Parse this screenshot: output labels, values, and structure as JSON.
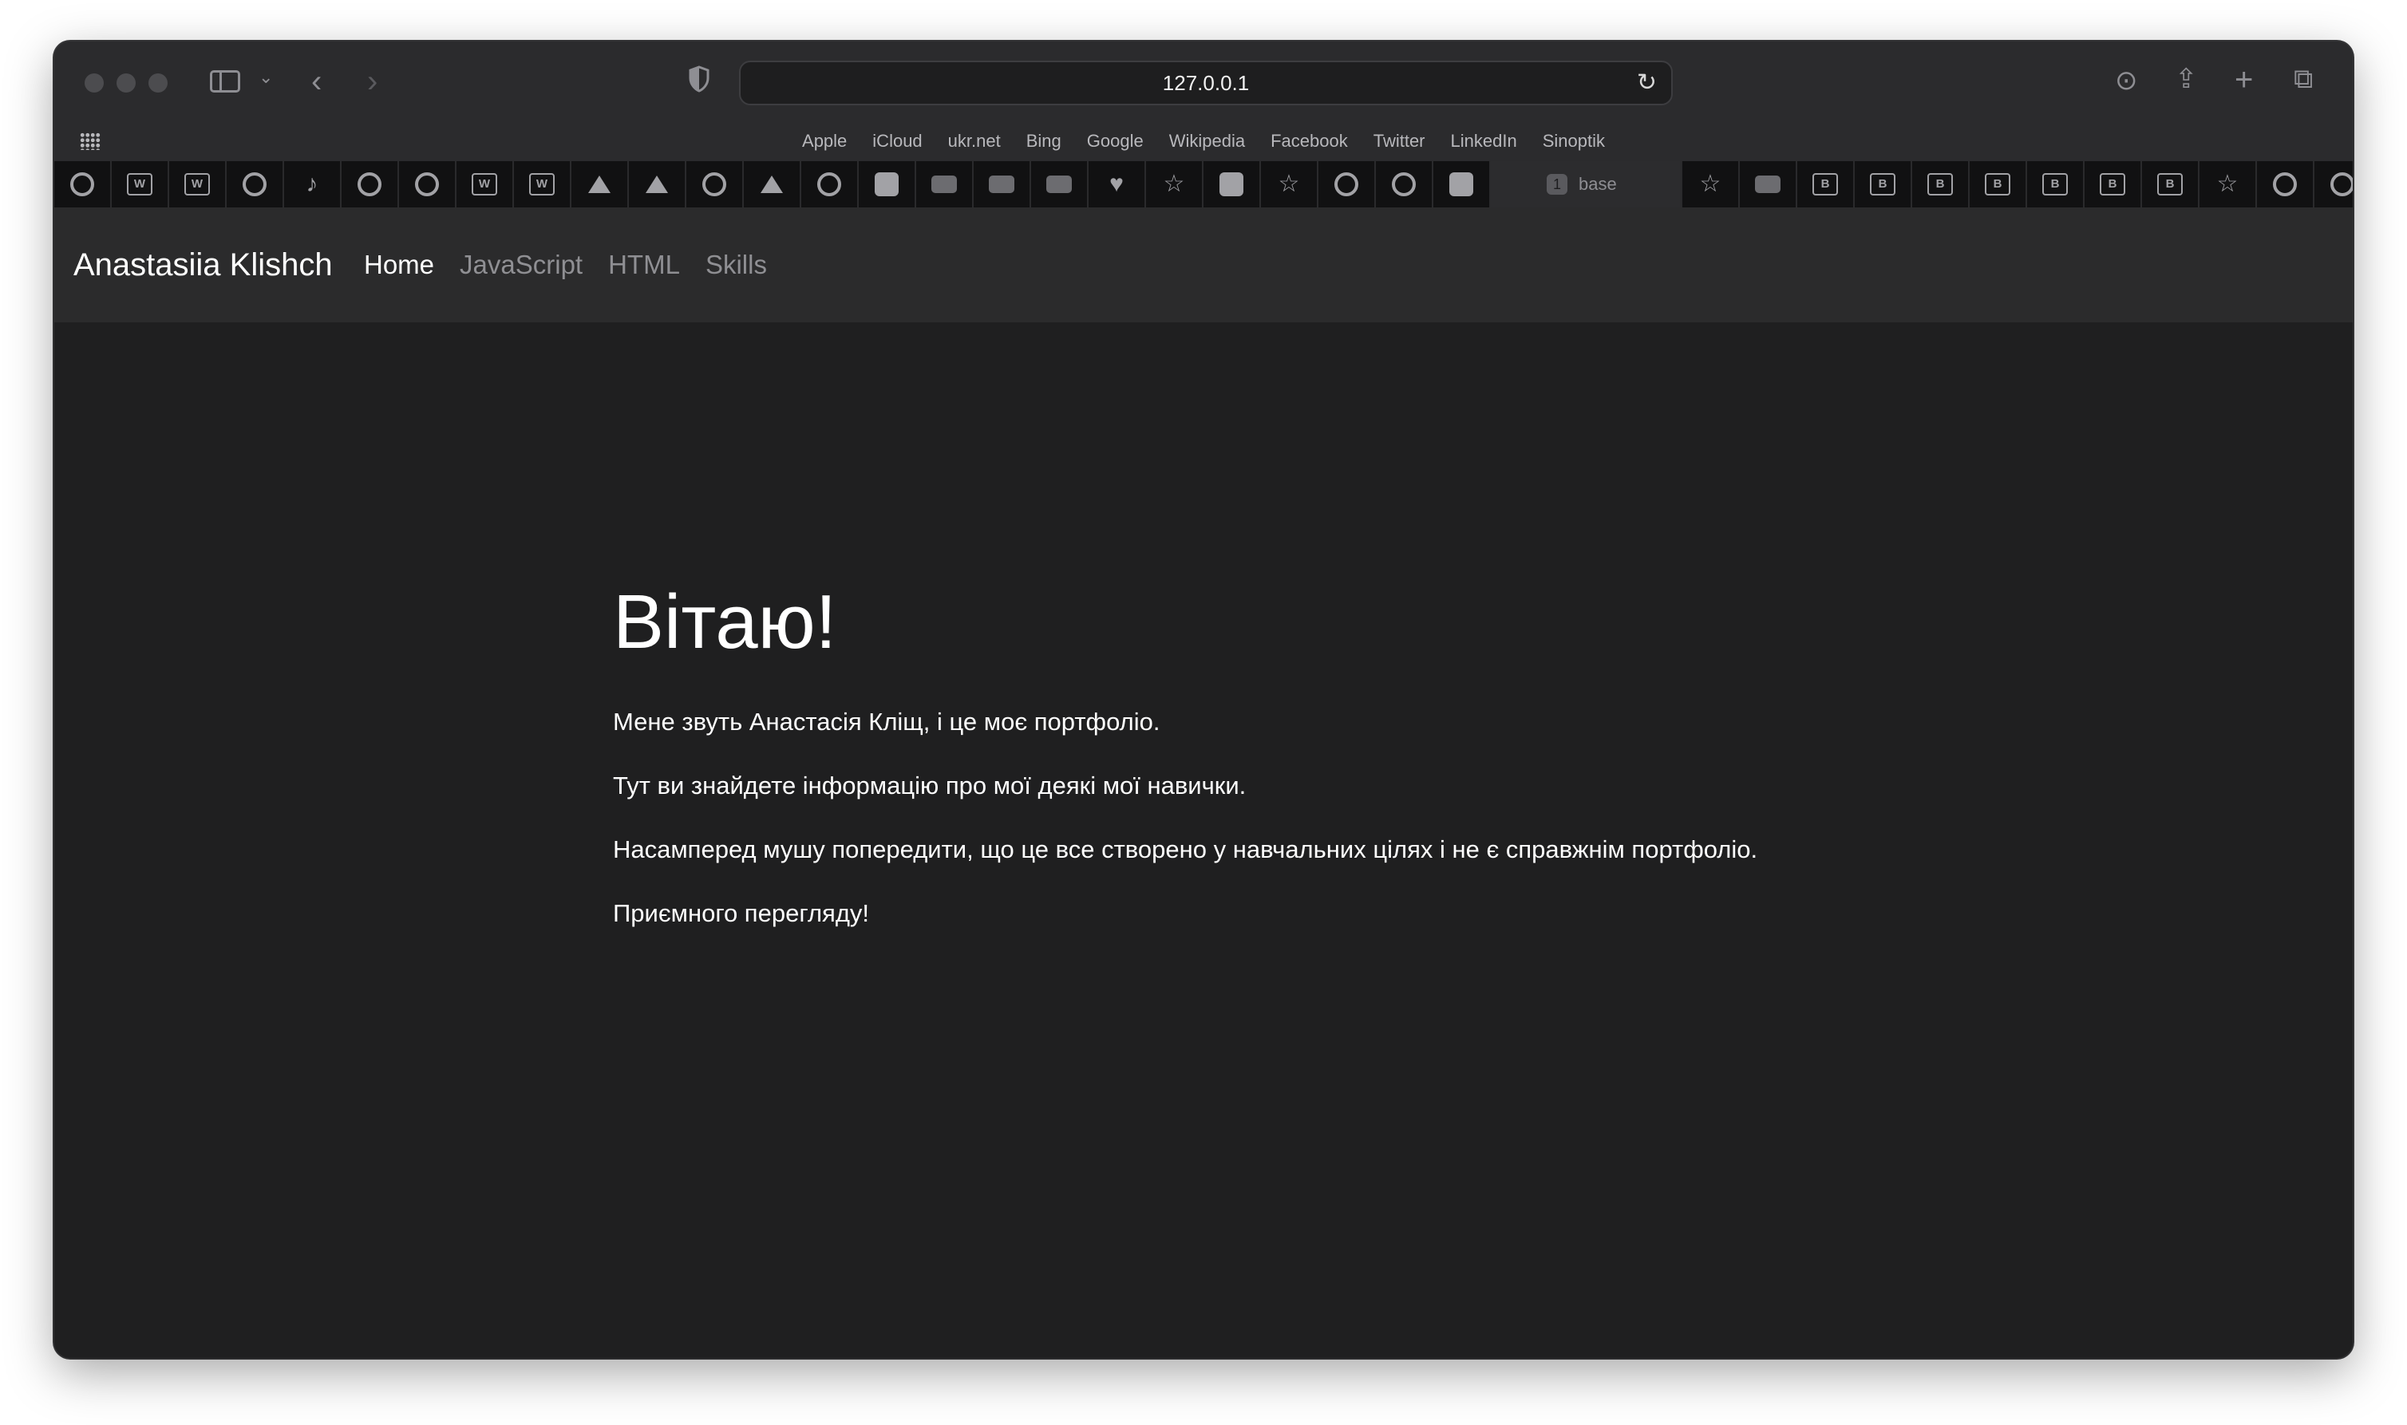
{
  "browser": {
    "url": "127.0.0.1",
    "favorites": [
      "Apple",
      "iCloud",
      "ukr.net",
      "Bing",
      "Google",
      "Wikipedia",
      "Facebook",
      "Twitter",
      "LinkedIn",
      "Sinoptik"
    ],
    "active_tab": {
      "number": "1",
      "label": "base"
    },
    "tab_icons": [
      "grammarly-icon",
      "w-document-icon",
      "w-document-icon",
      "grammarly-icon",
      "tiktok-icon",
      "grammarly-icon",
      "grammarly-icon",
      "w-document-icon",
      "w-document-icon",
      "drive-icon",
      "drive-icon",
      "grammarly-icon",
      "drive-icon",
      "grammarly-icon",
      "app-icon",
      "video-icon",
      "contact-card-icon",
      "contact-card-icon",
      "heart-icon",
      "star-icon",
      "notion-icon",
      "star-icon",
      "grammarly-icon",
      "grammarly-icon",
      "github-icon"
    ],
    "tab_icons_after": [
      "star-icon",
      "video-call-icon",
      "bootstrap-icon",
      "bootstrap-icon",
      "bootstrap-icon",
      "bootstrap-icon",
      "bootstrap-icon",
      "bootstrap-icon",
      "bootstrap-icon",
      "star-icon",
      "grammarly-icon",
      "grammarly-icon"
    ]
  },
  "site": {
    "brand": "Anastasiia Klishch",
    "nav": [
      {
        "label": "Home",
        "active": true
      },
      {
        "label": "JavaScript",
        "active": false
      },
      {
        "label": "HTML",
        "active": false
      },
      {
        "label": "Skills",
        "active": false
      }
    ],
    "heading": "Вітаю!",
    "paragraphs": [
      "Мене звуть Анастасія Кліщ, і це моє портфоліо.",
      "Тут ви знайдете інформацію про мої деякі мої навички.",
      "Насамперед мушу попередити, що це все створено у навчальних цілях і не є справжнім портфоліо.",
      "Приємного перегляду!"
    ]
  }
}
